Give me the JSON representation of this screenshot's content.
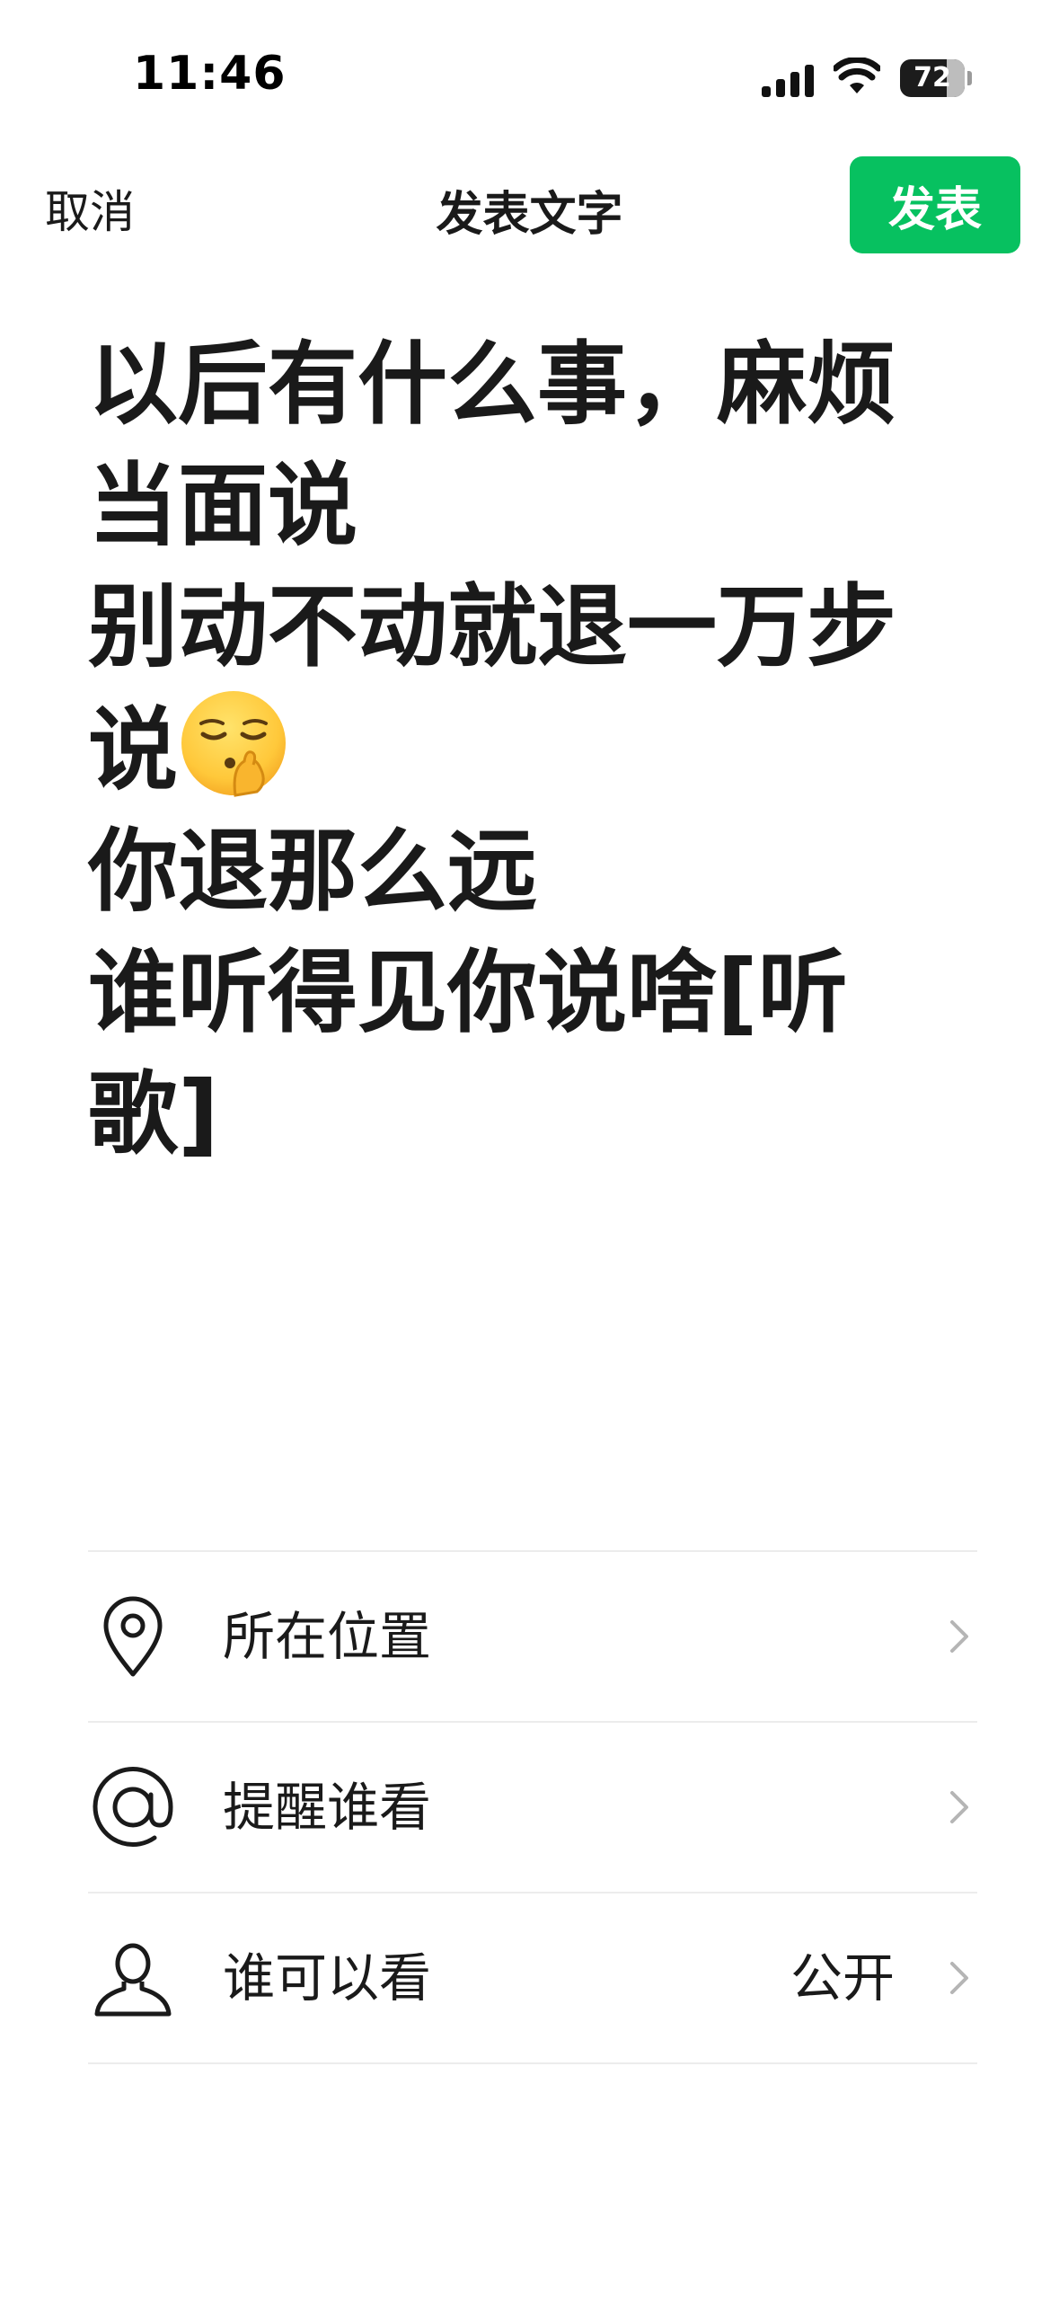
{
  "status_bar": {
    "time": "11:46",
    "battery_percent": "72",
    "battery_level": 0.72
  },
  "nav": {
    "cancel_label": "取消",
    "title": "发表文字",
    "publish_label": "发表"
  },
  "post": {
    "line1": "以后有什么事，麻烦当面说",
    "line2": "别动不动就退一万步说",
    "emoji": "shushing-face-emoji",
    "line3": "你退那么远",
    "line4": "谁听得见你说啥[听歌]"
  },
  "options": {
    "location": {
      "label": "所在位置",
      "icon": "location-pin-icon"
    },
    "mention": {
      "label": "提醒谁看",
      "icon": "at-sign-icon"
    },
    "visibility": {
      "label": "谁可以看",
      "value": "公开",
      "icon": "person-icon"
    }
  },
  "colors": {
    "accent": "#07c160",
    "text": "#1a1a1a",
    "divider": "#ececec"
  }
}
